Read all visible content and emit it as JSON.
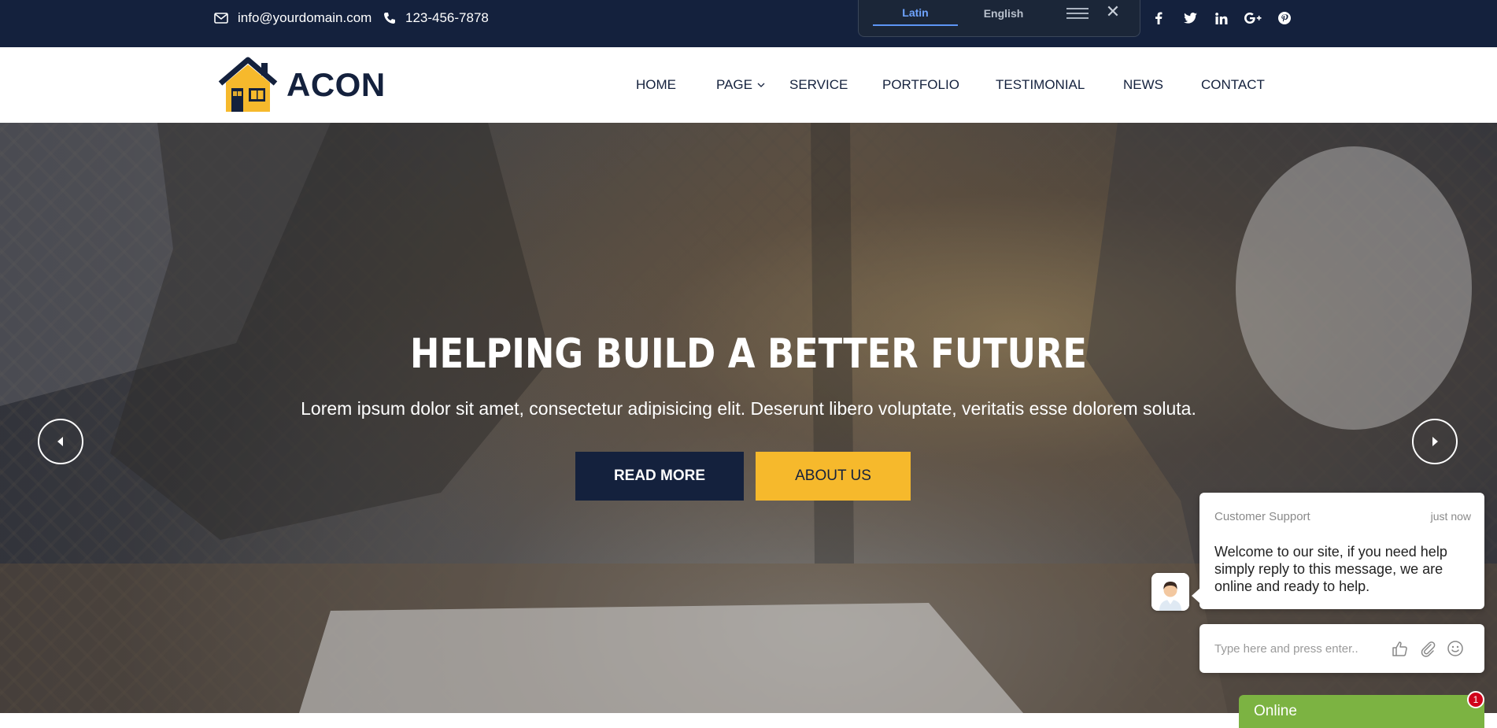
{
  "topbar": {
    "email": "info@yourdomain.com",
    "phone": "123-456-7878",
    "socials": [
      {
        "name": "facebook",
        "glyph": "f"
      },
      {
        "name": "twitter",
        "glyph": "🐦"
      },
      {
        "name": "linkedin",
        "glyph": "in"
      },
      {
        "name": "google-plus",
        "glyph": "G+"
      },
      {
        "name": "pinterest",
        "glyph": "P"
      }
    ]
  },
  "translate": {
    "languages": [
      "Latin",
      "English"
    ],
    "active": "Latin"
  },
  "brand": {
    "name": "ACON"
  },
  "nav": {
    "items": [
      "HOME",
      "PAGE",
      "SERVICE",
      "PORTFOLIO",
      "TESTIMONIAL",
      "NEWS",
      "CONTACT"
    ]
  },
  "hero": {
    "title": "HELPING BUILD A BETTER FUTURE",
    "subtitle": "Lorem ipsum dolor sit amet, consectetur adipisicing elit. Deserunt libero voluptate, veritatis esse dolorem soluta.",
    "read_more": "READ MORE",
    "about_us": "ABOUT US"
  },
  "chat": {
    "agent": "Customer Support",
    "time": "just now",
    "message": "Welcome to our site, if you need help simply reply to this message, we are online and ready to help.",
    "input_placeholder": "Type here and press enter..",
    "status": "Online",
    "badge_count": "1"
  },
  "colors": {
    "navy": "#14213d",
    "accent": "#f6b92c",
    "online": "#7cb342"
  }
}
